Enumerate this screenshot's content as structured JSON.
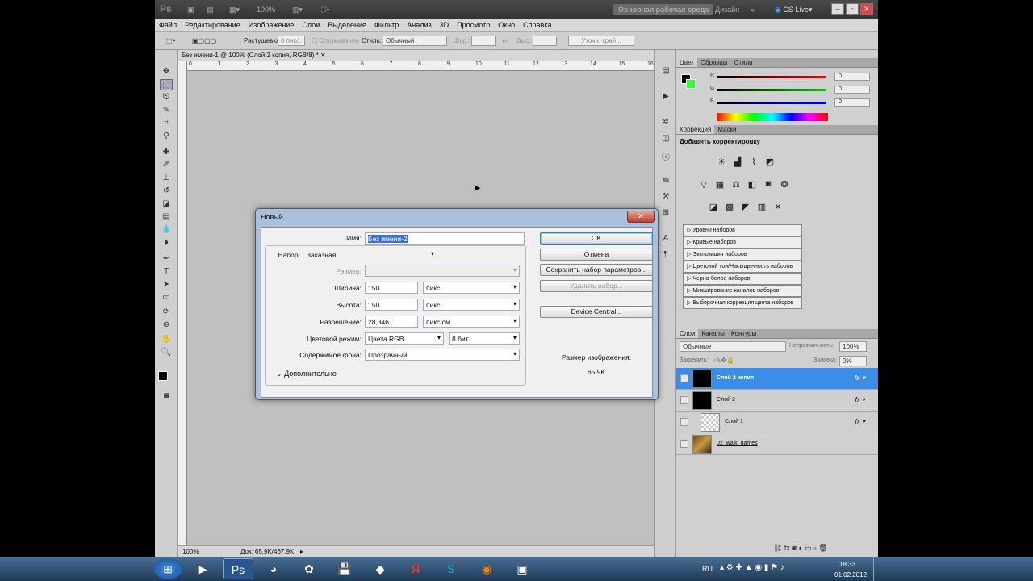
{
  "app": {
    "logo": "Ps",
    "zoom": "100%",
    "workspace_active": "Основная рабочая среда",
    "workspace_design": "Дизайн",
    "cslive": "CS Live"
  },
  "menu": [
    "Файл",
    "Редактирование",
    "Изображение",
    "Слои",
    "Выделение",
    "Фильтр",
    "Анализ",
    "3D",
    "Просмотр",
    "Окно",
    "Справка"
  ],
  "options": {
    "feather_label": "Растушевка:",
    "feather_value": "0 пикс.",
    "antialias": "Сглаживание",
    "style_label": "Стиль:",
    "style_value": "Обычный",
    "width_label": "Шир.:",
    "height_label": "Выс.:",
    "refine": "Уточн. край..."
  },
  "document": {
    "tab": "Без имени-1 @ 100% (Слой 2 копия, RGB/8) *",
    "ruler": [
      "0",
      "1",
      "2",
      "3",
      "4",
      "5",
      "6",
      "7",
      "8",
      "9",
      "10",
      "11",
      "12",
      "13",
      "14",
      "15",
      "16"
    ],
    "status_zoom": "100%",
    "status_doc": "Док: 65,9K/467,9K"
  },
  "color_panel": {
    "tabs": [
      "Цвет",
      "Образцы",
      "Стили"
    ],
    "channels": [
      {
        "label": "R",
        "value": "0"
      },
      {
        "label": "G",
        "value": "0"
      },
      {
        "label": "B",
        "value": "0"
      }
    ]
  },
  "adjust_panel": {
    "tabs": [
      "Коррекция",
      "Маски"
    ],
    "header": "Добавить корректировку",
    "presets": [
      "Уровни наборов",
      "Кривые наборов",
      "Экспозиция наборов",
      "Цветовой тон/Насыщенность наборов",
      "Черно-белое наборов",
      "Микширование каналов наборов",
      "Выборочная коррекция цвета наборов"
    ]
  },
  "layers_panel": {
    "tabs": [
      "Слои",
      "Каналы",
      "Контуры"
    ],
    "blend": "Обычные",
    "opacity_label": "Непрозрачность:",
    "opacity": "100%",
    "lock_label": "Закрепить:",
    "fill_label": "Заливка:",
    "fill": "0%",
    "layers": [
      {
        "name": "Слой 2 копия",
        "selected": true,
        "thumb": "black"
      },
      {
        "name": "Слой 2",
        "selected": false,
        "thumb": "black"
      },
      {
        "name": "Слой 1",
        "selected": false,
        "thumb": "transparent"
      },
      {
        "name": "02_walk_games",
        "selected": false,
        "thumb": "photo"
      }
    ]
  },
  "dialog": {
    "title": "Новый",
    "name_label": "Имя:",
    "name_value": "Без имени-2",
    "preset_label": "Набор:",
    "preset_value": "Заказная",
    "size_label": "Размер:",
    "width_label": "Ширина:",
    "width_value": "150",
    "width_unit": "пикс.",
    "height_label": "Высота:",
    "height_value": "150",
    "height_unit": "пикс.",
    "res_label": "Разрешение:",
    "res_value": "28,346",
    "res_unit": "пикс/см",
    "mode_label": "Цветовой режим:",
    "mode_value": "Цвета RGB",
    "bits_value": "8 бит",
    "bg_label": "Содержимое фона:",
    "bg_value": "Прозрачный",
    "advanced": "Дополнительно",
    "ok": "OK",
    "cancel": "Отмена",
    "save_preset": "Сохранить набор параметров...",
    "delete_preset": "Удалить набор...",
    "device_central": "Device Central...",
    "image_size_label": "Размер изображения:",
    "image_size_value": "65,9K"
  },
  "taskbar": {
    "lang": "RU",
    "time": "18:33",
    "date": "01.02.2012"
  }
}
